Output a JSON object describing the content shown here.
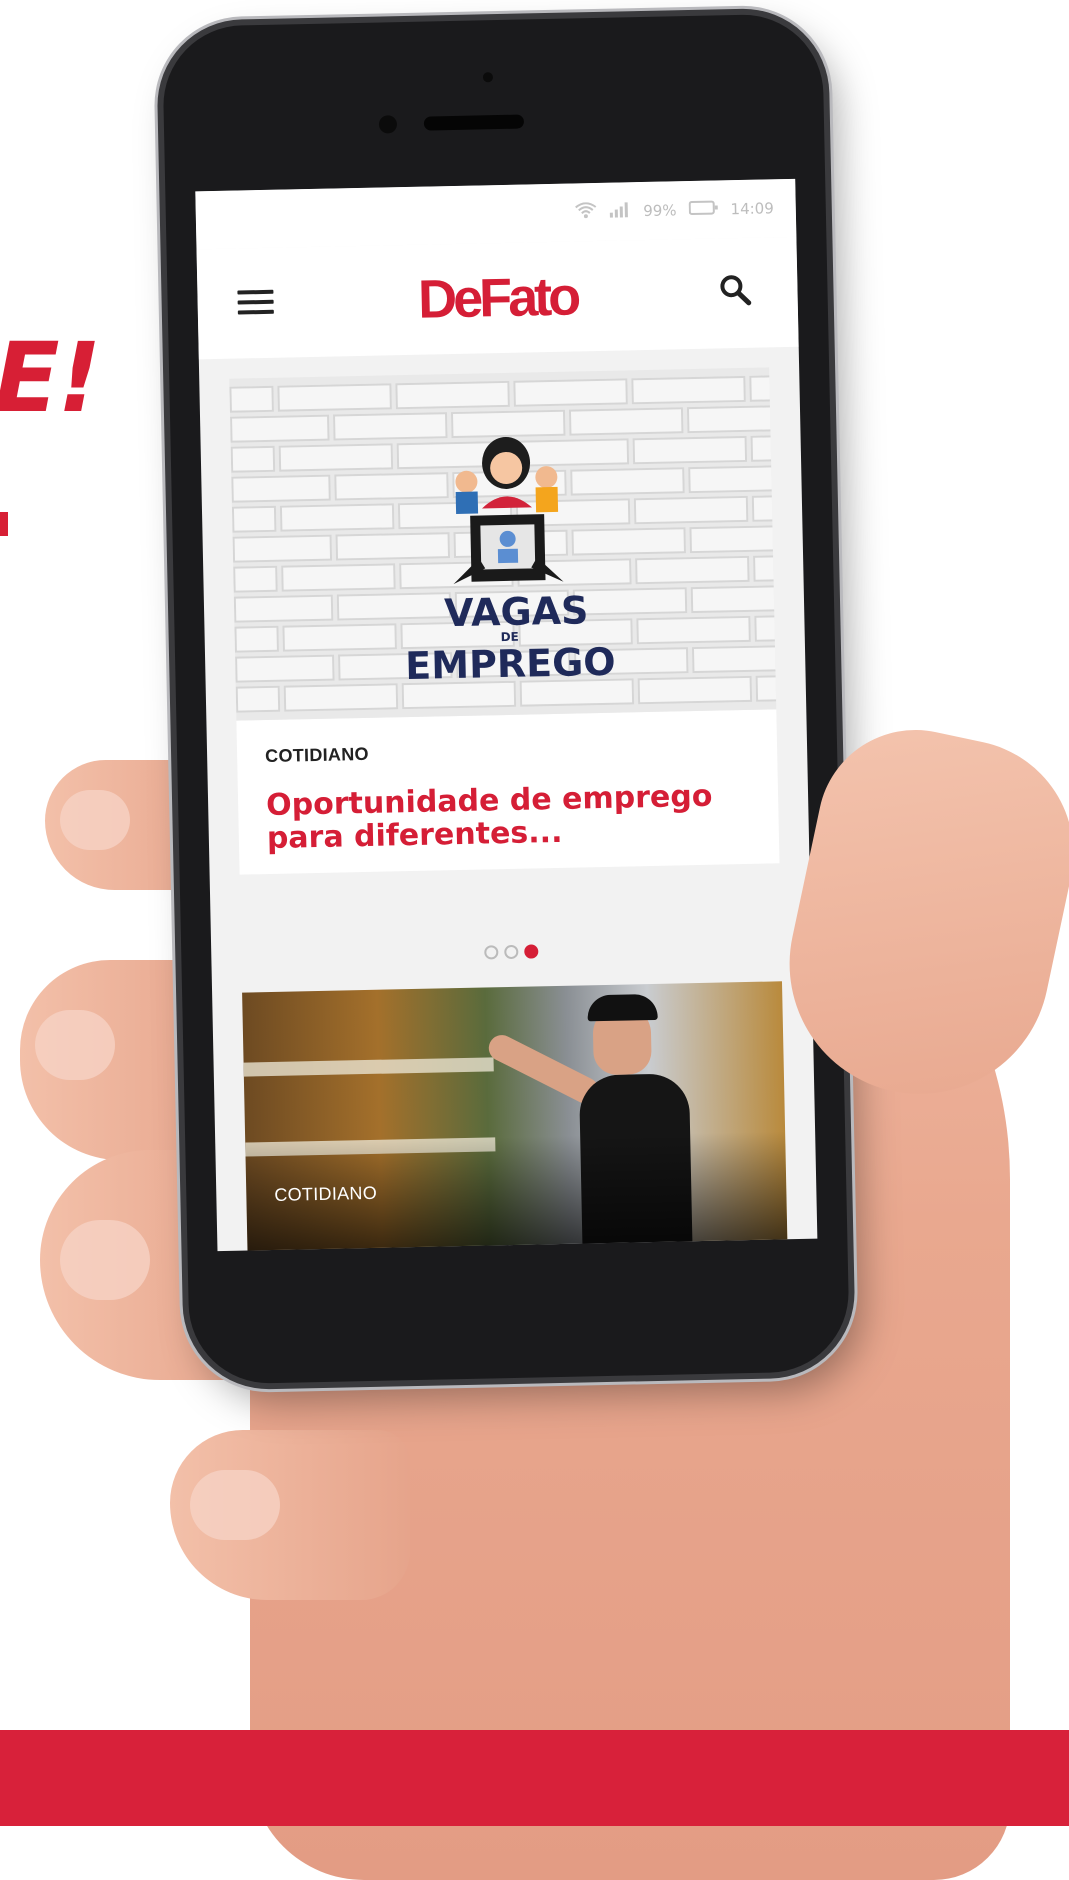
{
  "promo": {
    "fragment_text": "E!"
  },
  "phone": {
    "status_bar": {
      "battery": "99%",
      "time": "14:09"
    },
    "app": {
      "brand": "DeFato",
      "menu_icon": "hamburger-menu-icon",
      "search_icon": "search-icon",
      "featured_carousel": {
        "image_text_line1": "VAGAS",
        "image_text_line2": "DE",
        "image_text_line3": "EMPREGO",
        "category": "COTIDIANO",
        "headline": "Oportunidade de emprego para diferentes...",
        "pages": 3,
        "active_page": 3
      },
      "second_card": {
        "category": "COTIDIANO"
      }
    }
  },
  "colors": {
    "brand_red": "#d51e36",
    "band_red": "#d8213a"
  }
}
